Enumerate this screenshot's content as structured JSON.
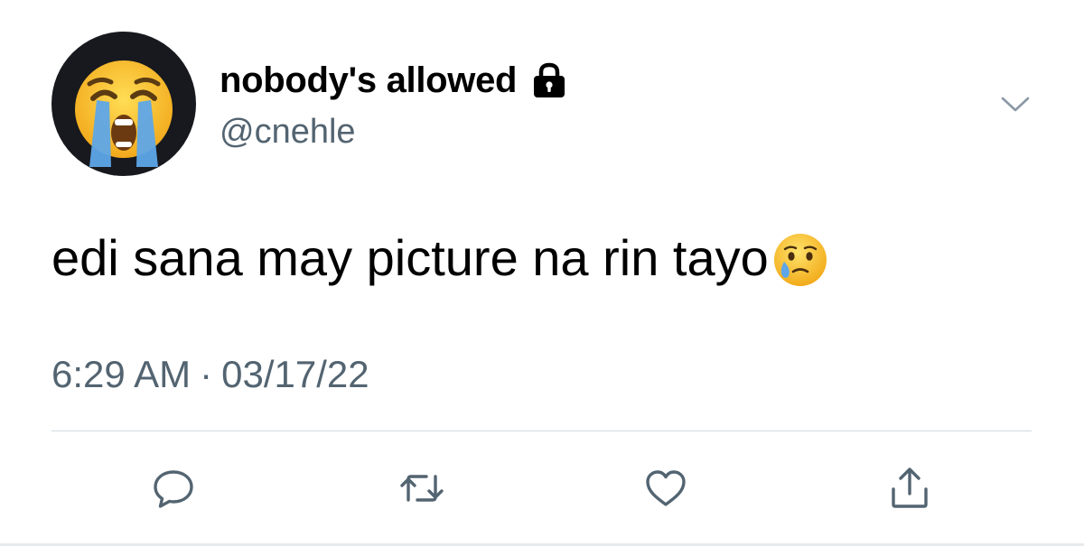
{
  "tweet": {
    "author": {
      "display_name": "nobody's allowed",
      "handle": "@cnehle",
      "avatar_icon": "loudly-crying-face-icon",
      "protected_icon": "lock-icon"
    },
    "text": "edi sana may picture na rin tayo",
    "text_emoji": "face-holding-back-tears-icon",
    "time": "6:29 AM",
    "separator": "·",
    "date": "03/17/22",
    "more_icon": "chevron-down-icon"
  },
  "actions": [
    {
      "name": "reply",
      "icon": "reply-bubble-icon"
    },
    {
      "name": "retweet",
      "icon": "retweet-icon"
    },
    {
      "name": "like",
      "icon": "heart-icon"
    },
    {
      "name": "share",
      "icon": "share-icon"
    }
  ],
  "colors": {
    "text_primary": "#000000",
    "text_secondary": "#536471",
    "divider": "#cfd9de",
    "avatar_bg": "#17191e",
    "emoji_yellow": "#f7c12e",
    "tear_blue": "#5ea6e8"
  }
}
